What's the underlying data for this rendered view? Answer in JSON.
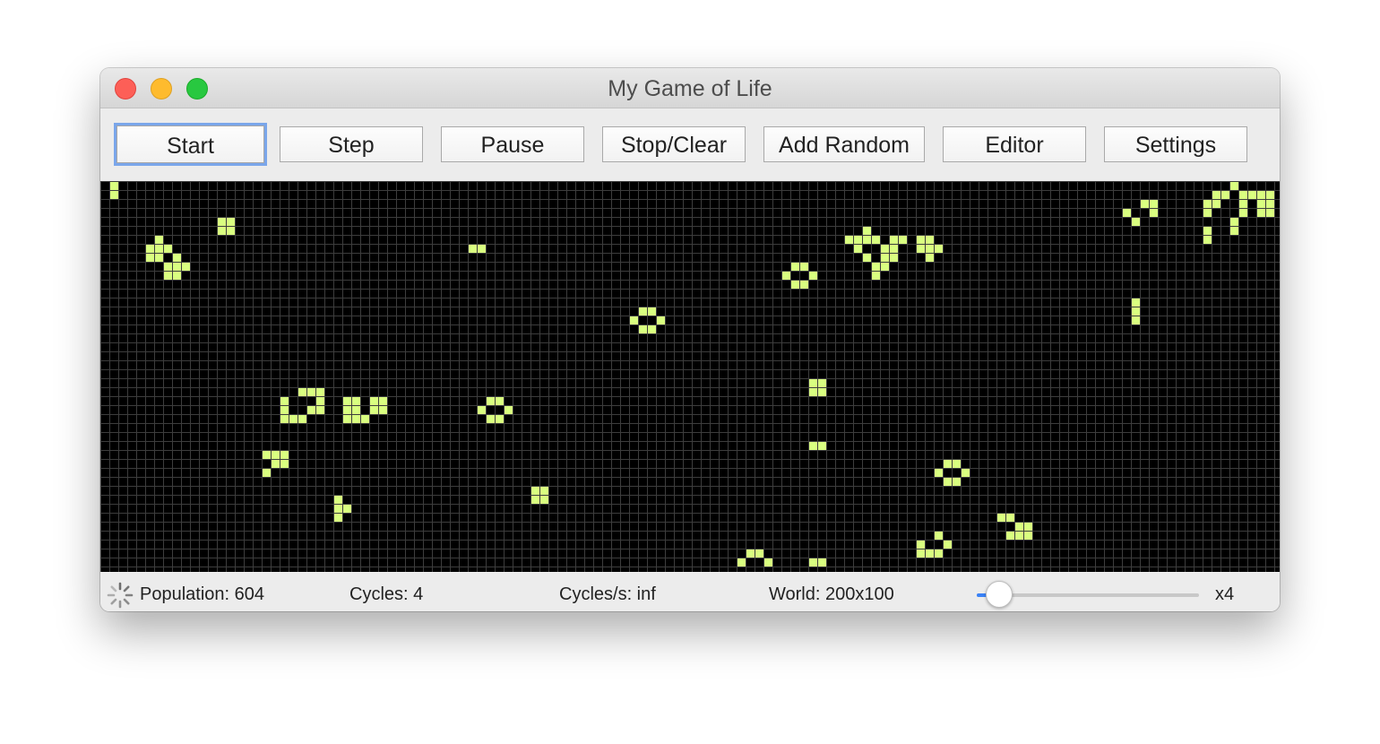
{
  "window": {
    "title": "My Game of Life"
  },
  "toolbar": {
    "buttons": [
      {
        "id": "start",
        "label": "Start",
        "focused": true
      },
      {
        "id": "step",
        "label": "Step"
      },
      {
        "id": "pause",
        "label": "Pause"
      },
      {
        "id": "stop-clear",
        "label": "Stop/Clear"
      },
      {
        "id": "add-random",
        "label": "Add Random"
      },
      {
        "id": "editor",
        "label": "Editor"
      },
      {
        "id": "settings",
        "label": "Settings"
      }
    ]
  },
  "grid": {
    "background": "#000000",
    "line_color": "#3d3d3d",
    "alive_color": "#d9ff80",
    "visible_cols": 131,
    "visible_rows": 43,
    "alive_cells": [
      [
        1,
        0
      ],
      [
        1,
        1
      ],
      [
        13,
        4
      ],
      [
        14,
        4
      ],
      [
        13,
        5
      ],
      [
        14,
        5
      ],
      [
        6,
        6
      ],
      [
        5,
        7
      ],
      [
        6,
        7
      ],
      [
        7,
        7
      ],
      [
        5,
        8
      ],
      [
        6,
        8
      ],
      [
        8,
        8
      ],
      [
        7,
        9
      ],
      [
        8,
        9
      ],
      [
        9,
        9
      ],
      [
        7,
        10
      ],
      [
        8,
        10
      ],
      [
        41,
        7
      ],
      [
        42,
        7
      ],
      [
        77,
        9
      ],
      [
        78,
        9
      ],
      [
        76,
        10
      ],
      [
        79,
        10
      ],
      [
        77,
        11
      ],
      [
        78,
        11
      ],
      [
        60,
        14
      ],
      [
        61,
        14
      ],
      [
        59,
        15
      ],
      [
        62,
        15
      ],
      [
        60,
        16
      ],
      [
        61,
        16
      ],
      [
        79,
        22
      ],
      [
        80,
        22
      ],
      [
        79,
        23
      ],
      [
        80,
        23
      ],
      [
        22,
        23
      ],
      [
        23,
        23
      ],
      [
        24,
        23
      ],
      [
        20,
        24
      ],
      [
        24,
        24
      ],
      [
        20,
        25
      ],
      [
        23,
        25
      ],
      [
        24,
        25
      ],
      [
        20,
        26
      ],
      [
        21,
        26
      ],
      [
        22,
        26
      ],
      [
        27,
        24
      ],
      [
        28,
        24
      ],
      [
        30,
        24
      ],
      [
        31,
        24
      ],
      [
        27,
        25
      ],
      [
        28,
        25
      ],
      [
        30,
        25
      ],
      [
        31,
        25
      ],
      [
        27,
        26
      ],
      [
        28,
        26
      ],
      [
        29,
        26
      ],
      [
        43,
        24
      ],
      [
        44,
        24
      ],
      [
        42,
        25
      ],
      [
        45,
        25
      ],
      [
        43,
        26
      ],
      [
        44,
        26
      ],
      [
        79,
        29
      ],
      [
        80,
        29
      ],
      [
        18,
        30
      ],
      [
        19,
        30
      ],
      [
        20,
        30
      ],
      [
        19,
        31
      ],
      [
        20,
        31
      ],
      [
        18,
        32
      ],
      [
        94,
        31
      ],
      [
        95,
        31
      ],
      [
        93,
        32
      ],
      [
        96,
        32
      ],
      [
        94,
        33
      ],
      [
        95,
        33
      ],
      [
        48,
        34
      ],
      [
        49,
        34
      ],
      [
        48,
        35
      ],
      [
        49,
        35
      ],
      [
        26,
        35
      ],
      [
        26,
        36
      ],
      [
        27,
        36
      ],
      [
        26,
        37
      ],
      [
        100,
        37
      ],
      [
        101,
        37
      ],
      [
        102,
        38
      ],
      [
        103,
        38
      ],
      [
        101,
        39
      ],
      [
        102,
        39
      ],
      [
        103,
        39
      ],
      [
        93,
        39
      ],
      [
        91,
        40
      ],
      [
        94,
        40
      ],
      [
        91,
        41
      ],
      [
        92,
        41
      ],
      [
        93,
        41
      ],
      [
        72,
        41
      ],
      [
        73,
        41
      ],
      [
        71,
        42
      ],
      [
        74,
        42
      ],
      [
        79,
        42
      ],
      [
        80,
        42
      ],
      [
        85,
        5
      ],
      [
        83,
        6
      ],
      [
        84,
        6
      ],
      [
        85,
        6
      ],
      [
        86,
        6
      ],
      [
        88,
        6
      ],
      [
        89,
        6
      ],
      [
        91,
        6
      ],
      [
        92,
        6
      ],
      [
        84,
        7
      ],
      [
        87,
        7
      ],
      [
        88,
        7
      ],
      [
        91,
        7
      ],
      [
        92,
        7
      ],
      [
        93,
        7
      ],
      [
        85,
        8
      ],
      [
        87,
        8
      ],
      [
        88,
        8
      ],
      [
        92,
        8
      ],
      [
        86,
        9
      ],
      [
        87,
        9
      ],
      [
        86,
        10
      ],
      [
        116,
        2
      ],
      [
        117,
        2
      ],
      [
        114,
        3
      ],
      [
        117,
        3
      ],
      [
        115,
        4
      ],
      [
        115,
        13
      ],
      [
        115,
        14
      ],
      [
        115,
        15
      ],
      [
        126,
        0
      ],
      [
        124,
        1
      ],
      [
        125,
        1
      ],
      [
        127,
        1
      ],
      [
        128,
        1
      ],
      [
        129,
        1
      ],
      [
        130,
        1
      ],
      [
        123,
        2
      ],
      [
        124,
        2
      ],
      [
        127,
        2
      ],
      [
        129,
        2
      ],
      [
        130,
        2
      ],
      [
        123,
        3
      ],
      [
        127,
        3
      ],
      [
        129,
        3
      ],
      [
        130,
        3
      ],
      [
        126,
        4
      ],
      [
        123,
        5
      ],
      [
        126,
        5
      ],
      [
        123,
        6
      ]
    ]
  },
  "status": {
    "population": "Population: 604",
    "cycles": "Cycles: 4",
    "cycles_per_sec": "Cycles/s: inf",
    "world": "World: 200x100",
    "speed_label": "x4",
    "speed_slider_fraction": 0.1
  }
}
